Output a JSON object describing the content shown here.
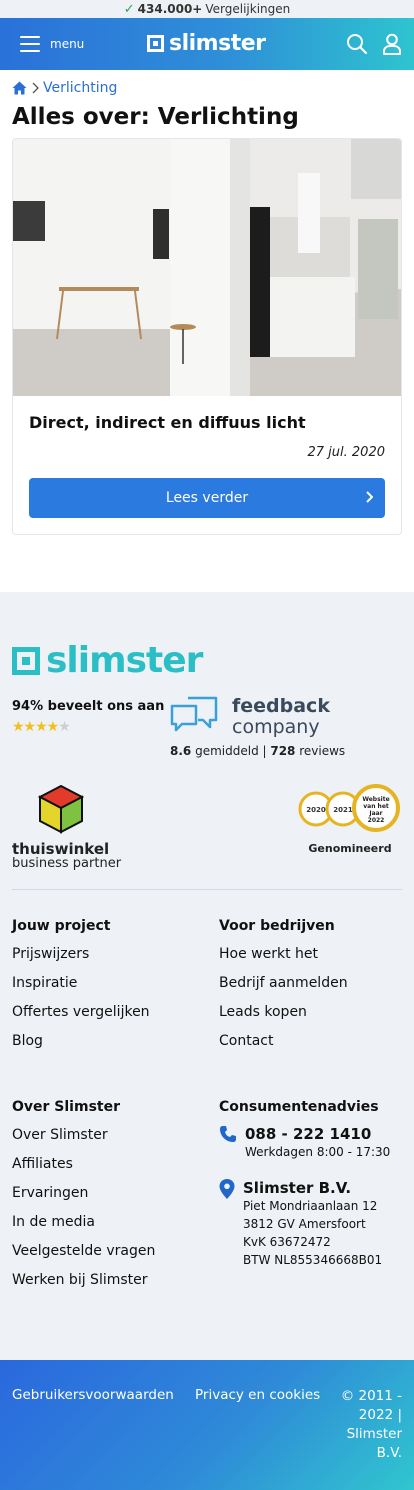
{
  "topbar": {
    "count": "434.000+",
    "label": "Vergelijkingen"
  },
  "header": {
    "menu_label": "menu",
    "logo": "slimster"
  },
  "breadcrumb": {
    "current": "Verlichting"
  },
  "page_title": "Alles over: Verlichting",
  "article": {
    "title": "Direct, indirect en diffuus licht",
    "date": "27 jul. 2020",
    "button": "Lees verder"
  },
  "footer": {
    "logo": "slimster",
    "recommend": "94% beveelt ons aan",
    "stars_filled": 4,
    "feedback": {
      "title": "feedback",
      "subtitle": "company",
      "score": "8.6",
      "score_label": "gemiddeld",
      "reviews": "728",
      "reviews_label": "reviews"
    },
    "thuiswinkel": {
      "line1": "thuiswinkel",
      "line2": "business partner"
    },
    "awards": {
      "years": [
        "2020",
        "2021"
      ],
      "badge": "Website van het Jaar 2022",
      "label": "Genomineerd"
    },
    "columns": {
      "project": {
        "heading": "Jouw project",
        "links": [
          "Prijswijzers",
          "Inspiratie",
          "Offertes vergelijken",
          "Blog"
        ]
      },
      "business": {
        "heading": "Voor bedrijven",
        "links": [
          "Hoe werkt het",
          "Bedrijf aanmelden",
          "Leads kopen",
          "Contact"
        ]
      },
      "about": {
        "heading": "Over Slimster",
        "links": [
          "Over Slimster",
          "Affiliates",
          "Ervaringen",
          "In de media",
          "Veelgestelde vragen",
          "Werken bij Slimster"
        ]
      },
      "consumer": {
        "heading": "Consumentenadvies",
        "phone": "088 - 222 1410",
        "hours": "Werkdagen 8:00 - 17:30",
        "company": "Slimster B.V.",
        "address1": "Piet Mondriaanlaan 12",
        "address2": "3812 GV Amersfoort",
        "kvk": "KvK 63672472",
        "btw": "BTW NL855346668B01"
      }
    }
  },
  "bottom": {
    "terms": "Gebruikersvoorwaarden",
    "privacy": "Privacy en cookies",
    "copyright": "© 2011 - 2022 | Slimster B.V."
  },
  "colors": {
    "brand_blue": "#2b7ae0",
    "brand_teal": "#2bbfc5",
    "header_gradient_start": "#2a71d9",
    "header_gradient_end": "#2ec4cf"
  }
}
